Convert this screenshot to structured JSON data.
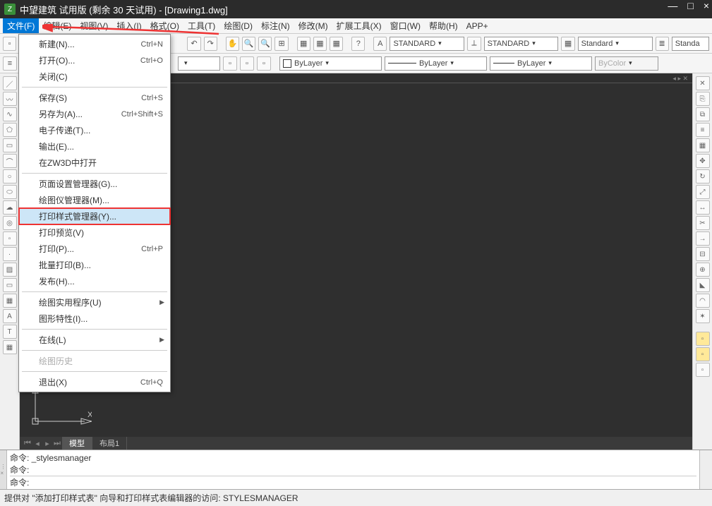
{
  "title": "中望建筑 试用版 (剩余 30 天试用)  - [Drawing1.dwg]",
  "menubar": [
    "文件(F)",
    "编辑(E)",
    "视图(V)",
    "插入(I)",
    "格式(O)",
    "工具(T)",
    "绘图(D)",
    "标注(N)",
    "修改(M)",
    "扩展工具(X)",
    "窗口(W)",
    "帮助(H)",
    "APP+"
  ],
  "filemenu": {
    "items": [
      {
        "label": "新建(N)...",
        "shortcut": "Ctrl+N"
      },
      {
        "label": "打开(O)...",
        "shortcut": "Ctrl+O"
      },
      {
        "label": "关闭(C)"
      },
      {
        "sep": true
      },
      {
        "label": "保存(S)",
        "shortcut": "Ctrl+S"
      },
      {
        "label": "另存为(A)...",
        "shortcut": "Ctrl+Shift+S"
      },
      {
        "label": "电子传递(T)..."
      },
      {
        "label": "输出(E)..."
      },
      {
        "label": "在ZW3D中打开"
      },
      {
        "sep": true
      },
      {
        "label": "页面设置管理器(G)..."
      },
      {
        "label": "绘图仪管理器(M)..."
      },
      {
        "label": "打印样式管理器(Y)...",
        "redbox": true,
        "highlighted": true
      },
      {
        "label": "打印预览(V)"
      },
      {
        "label": "打印(P)...",
        "shortcut": "Ctrl+P"
      },
      {
        "label": "批量打印(B)..."
      },
      {
        "label": "发布(H)..."
      },
      {
        "sep": true
      },
      {
        "label": "绘图实用程序(U)",
        "submenu": true
      },
      {
        "label": "图形特性(I)..."
      },
      {
        "sep": true
      },
      {
        "label": "在线(L)",
        "submenu": true
      },
      {
        "sep": true
      },
      {
        "label": "绘图历史",
        "disabled": true
      },
      {
        "sep": true
      },
      {
        "label": "退出(X)",
        "shortcut": "Ctrl+Q"
      }
    ]
  },
  "toolbar1": {
    "text_style": "STANDARD",
    "dim_style": "STANDARD",
    "table_style": "Standard",
    "mline_style": "Standa"
  },
  "toolbar2": {
    "layer_color_label": "ByLayer",
    "linetype": "ByLayer",
    "lineweight": "ByLayer",
    "plot_style": "ByColor"
  },
  "canvas": {
    "ucs_label": "X",
    "tabs": {
      "model": "模型",
      "layout1": "布局1"
    }
  },
  "cmd": {
    "line1": "命令: _stylesmanager",
    "line2": "命令:",
    "prompt": "命令:"
  },
  "status": "提供对 \"添加打印样式表\" 向导和打印样式表编辑器的访问:   STYLESMANAGER",
  "icons": {
    "x": "×"
  }
}
